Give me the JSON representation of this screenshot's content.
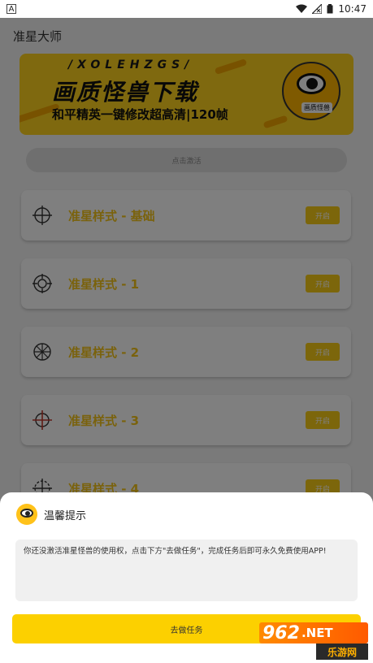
{
  "status_bar": {
    "left_indicator": "A",
    "time": "10:47"
  },
  "app": {
    "title": "准星大师",
    "banner": {
      "subtitle_en": "/XOLEHZGS/",
      "title": "画质怪兽下载",
      "slogan": "和平精英一键修改超高清|120帧",
      "mascot_badge": "画质怪兽"
    },
    "activate_label": "点击激活",
    "crosshair_items": [
      {
        "label": "准星样式 - 基础",
        "button": "开启",
        "icon": "crosshair-basic-icon"
      },
      {
        "label": "准星样式 - 1",
        "button": "开启",
        "icon": "crosshair-ring-icon"
      },
      {
        "label": "准星样式 - 2",
        "button": "开启",
        "icon": "crosshair-spoke-icon"
      },
      {
        "label": "准星样式 - 3",
        "button": "开启",
        "icon": "crosshair-red-icon"
      },
      {
        "label": "准星样式 - 4",
        "button": "开启",
        "icon": "crosshair-dashed-icon"
      }
    ]
  },
  "dialog": {
    "title": "温馨提示",
    "message": "你还没激活准星怪兽的使用权，点击下方\"去做任务\"，完成任务后即可永久免费使用APP!",
    "button": "去做任务"
  },
  "watermark": {
    "number": "962",
    "net": ".NET",
    "site": "乐游网"
  },
  "colors": {
    "accent": "#fcd000",
    "card_label": "#f5c518",
    "overlay": "rgba(0,0,0,0.5)"
  }
}
